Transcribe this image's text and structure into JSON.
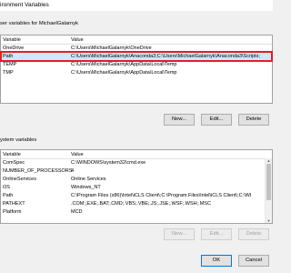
{
  "window": {
    "title": "ironment Variables"
  },
  "user_section": {
    "label": "ser variables for MichaelGalarnyk",
    "columns": [
      "Variable",
      "Value"
    ],
    "rows": [
      {
        "variable": "OneDrive",
        "value": "C:\\Users\\MichaelGalarnyk\\OneDrive"
      },
      {
        "variable": "Path",
        "value": "C:\\Users\\MichaelGalarnyk\\Anaconda3;C:\\Users\\MichaelGalarnyk\\Anaconda3\\Scripts;"
      },
      {
        "variable": "TEMP",
        "value": "C:\\Users\\MichaelGalarnyk\\AppData\\Local\\Temp"
      },
      {
        "variable": "TMP",
        "value": "C:\\Users\\MichaelGalarnyk\\AppData\\Local\\Temp"
      }
    ],
    "buttons": {
      "new": "New...",
      "edit": "Edit...",
      "delete": "Delete"
    }
  },
  "system_section": {
    "label": "ystem variables",
    "columns": [
      "Variable",
      "Value"
    ],
    "rows": [
      {
        "variable": "ComSpec",
        "value": "C:\\WINDOWS\\system32\\cmd.exe"
      },
      {
        "variable": "NUMBER_OF_PROCESSORS",
        "value": "4"
      },
      {
        "variable": "OnlineServices",
        "value": "Online Services"
      },
      {
        "variable": "OS",
        "value": "Windows_NT"
      },
      {
        "variable": "Path",
        "value": "C:\\Program Files (x86)\\Intel\\iCLS Client\\;C:\\Program Files\\Intel\\iCLS Client\\;C:\\WI"
      },
      {
        "variable": "PATHEXT",
        "value": ".COM;.EXE;.BAT;.CMD;.VBS;.VBE;.JS;.JSE;.WSF;.WSH;.MSC"
      },
      {
        "variable": "Platform",
        "value": "MCD"
      }
    ],
    "buttons": {
      "new": "New...",
      "edit": "Edit...",
      "delete": "Delete"
    }
  },
  "footer": {
    "ok": "OK",
    "cancel": "Cancel"
  },
  "colors": {
    "selection": "#cce8ff",
    "highlight_border": "#e02020",
    "default_button_border": "#0078d7"
  }
}
